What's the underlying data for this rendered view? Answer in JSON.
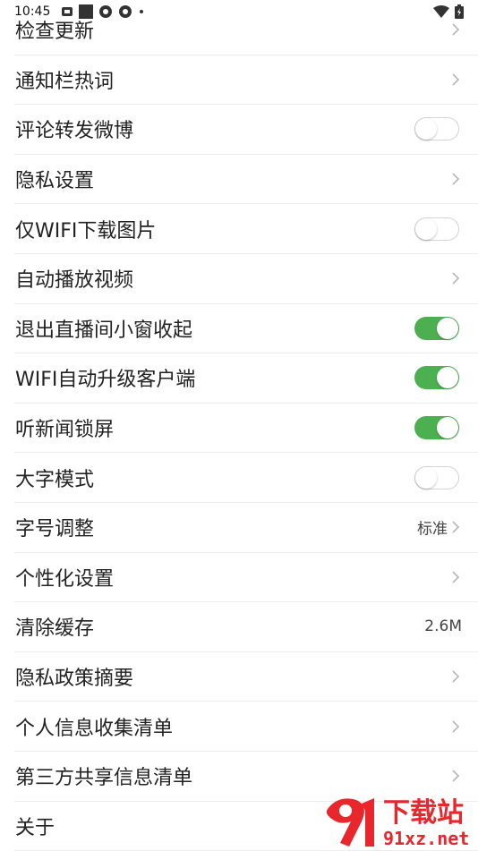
{
  "status_bar": {
    "time": "10:45"
  },
  "settings": [
    {
      "label": "检查更新",
      "control": "chevron"
    },
    {
      "label": "通知栏热词",
      "control": "chevron"
    },
    {
      "label": "评论转发微博",
      "control": "toggle",
      "on": false
    },
    {
      "label": "隐私设置",
      "control": "chevron"
    },
    {
      "label": "仅WIFI下载图片",
      "control": "toggle",
      "on": false
    },
    {
      "label": "自动播放视频",
      "control": "chevron"
    },
    {
      "label": "退出直播间小窗收起",
      "control": "toggle",
      "on": true
    },
    {
      "label": "WIFI自动升级客户端",
      "control": "toggle",
      "on": true
    },
    {
      "label": "听新闻锁屏",
      "control": "toggle",
      "on": true
    },
    {
      "label": "大字模式",
      "control": "toggle",
      "on": false
    },
    {
      "label": "字号调整",
      "control": "value-chevron",
      "value": "标准"
    },
    {
      "label": "个性化设置",
      "control": "chevron"
    },
    {
      "label": "清除缓存",
      "control": "value",
      "value": "2.6M"
    },
    {
      "label": "隐私政策摘要",
      "control": "chevron"
    },
    {
      "label": "个人信息收集清单",
      "control": "chevron"
    },
    {
      "label": "第三方共享信息清单",
      "control": "chevron"
    },
    {
      "label": "关于",
      "control": "none"
    }
  ],
  "watermark": {
    "text": "下载站",
    "url_text": "91xz.net"
  },
  "colors": {
    "toggle_on": "#4cb050",
    "watermark_red": "#e8262b"
  }
}
